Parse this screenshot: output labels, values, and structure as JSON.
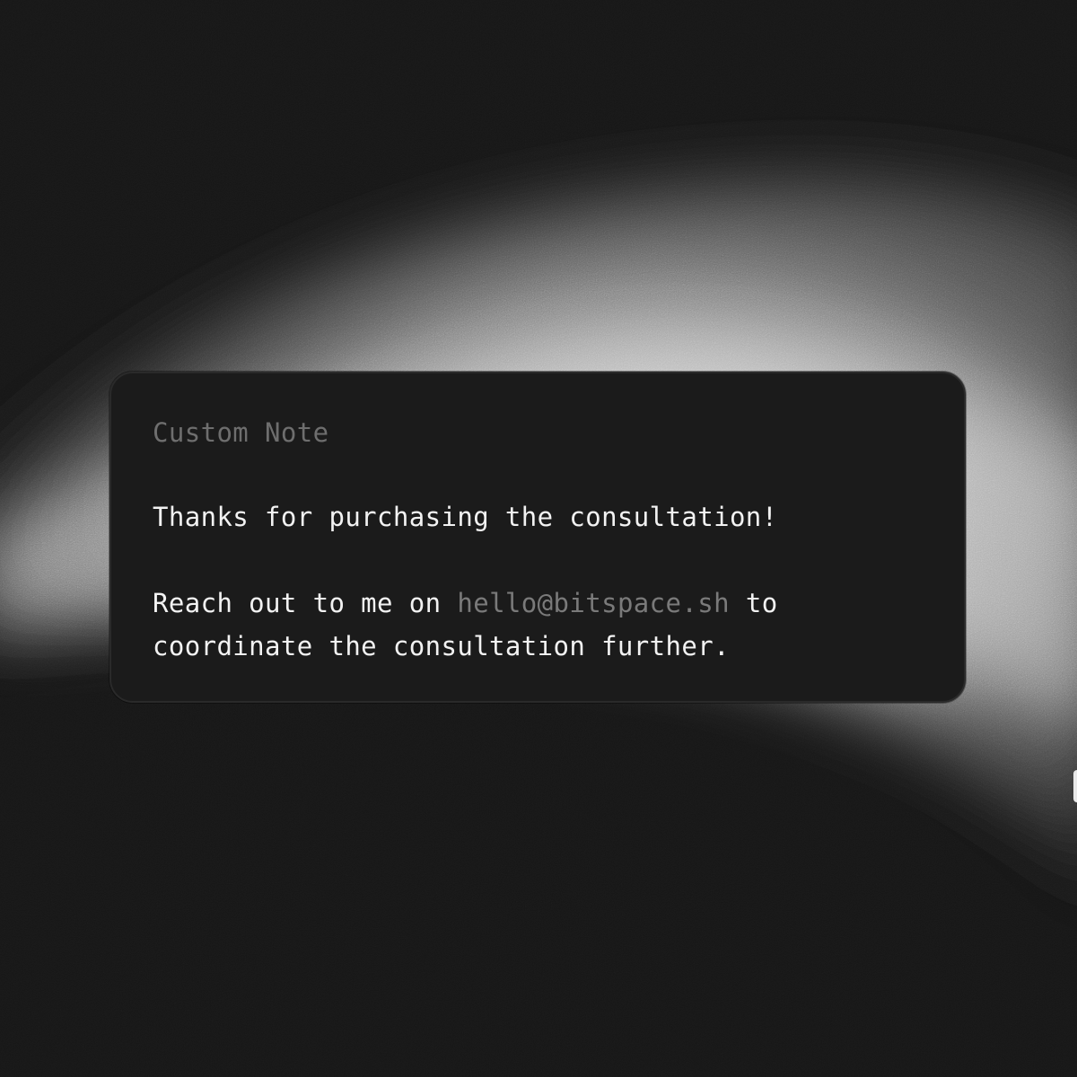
{
  "note": {
    "title": "Custom Note",
    "line1": "Thanks for purchasing the consultation!",
    "line2_prefix": "Reach out to me on ",
    "email": "hello@bitspace.sh",
    "line2_suffix": " to",
    "line3": "coordinate the consultation further."
  },
  "colors": {
    "background": "#161616",
    "card": "#1b1b1b",
    "title_text": "#6e6e6e",
    "body_text": "#f2f2f2",
    "email_text": "#7a7a7a"
  }
}
